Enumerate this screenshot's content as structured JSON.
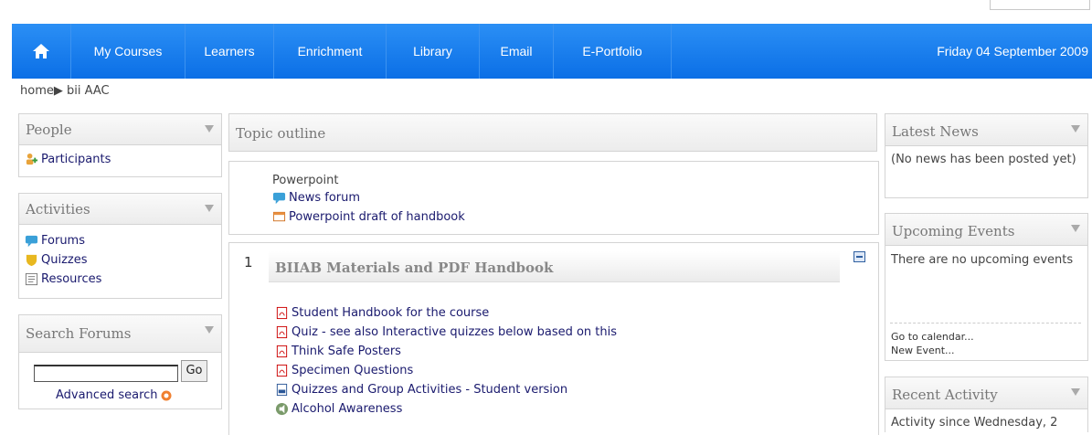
{
  "nav": {
    "items": [
      "My Courses",
      "Learners",
      "Enrichment",
      "Library",
      "Email",
      "E-Portfolio"
    ],
    "date": "Friday 04 September 2009"
  },
  "breadcrumb": {
    "home": "home",
    "sep": "▶",
    "course": "bii AAC"
  },
  "people": {
    "title": "People",
    "participants": "Participants"
  },
  "activities": {
    "title": "Activities",
    "forums": "Forums",
    "quizzes": "Quizzes",
    "resources": "Resources"
  },
  "search": {
    "title": "Search Forums",
    "button": "Go",
    "advanced": "Advanced search",
    "value": ""
  },
  "topic": {
    "title": "Topic outline",
    "section0": {
      "heading": "Powerpoint",
      "news": "News forum",
      "draft": "Powerpoint draft of handbook"
    },
    "section1": {
      "number": "1",
      "heading": "BIIAB Materials and PDF Handbook",
      "items": [
        "Student Handbook for the course",
        "Quiz - see also Interactive quizzes below based on this",
        "Think Safe Posters",
        "Specimen Questions",
        "Quizzes and Group Activities - Student version",
        "Alcohol Awareness"
      ]
    }
  },
  "news": {
    "title": "Latest News",
    "text": "(No news has been posted yet)"
  },
  "events": {
    "title": "Upcoming Events",
    "text": "There are no upcoming events",
    "calendar": "Go to calendar...",
    "newevent": "New Event..."
  },
  "recent": {
    "title": "Recent Activity",
    "text": "Activity since Wednesday, 2"
  },
  "colors": {
    "nav": "#0b6fe6",
    "link": "#1a1a6e",
    "header_text": "#777777"
  }
}
